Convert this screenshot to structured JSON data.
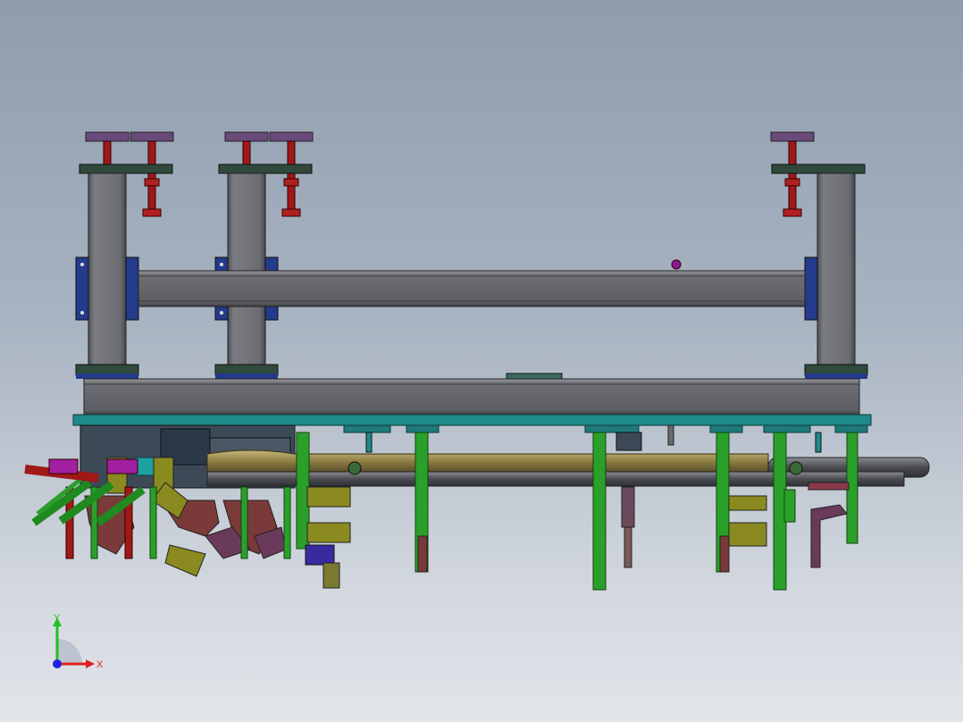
{
  "viewport": {
    "background_top": "#8e9cae",
    "background_bottom": "#e2e5ea"
  },
  "triad": {
    "x_label": "X",
    "y_label": "Y",
    "x_color": "#e02020",
    "y_color": "#20c020",
    "z_color": "#2020e0"
  },
  "colors": {
    "frame_gray": "#6b6d72",
    "plate_dark_green": "#2f4a3c",
    "teal_plate": "#1f8a8a",
    "screw_red": "#a01818",
    "pad_purple": "#6a4a8a",
    "bracket_blue": "#243a8a",
    "cylinder_green": "#2aa02a",
    "clamp_brown": "#7a3a2a",
    "clamp_olive": "#8a8a20",
    "part_gold": "#9a8a50",
    "magenta": "#a020a0"
  }
}
